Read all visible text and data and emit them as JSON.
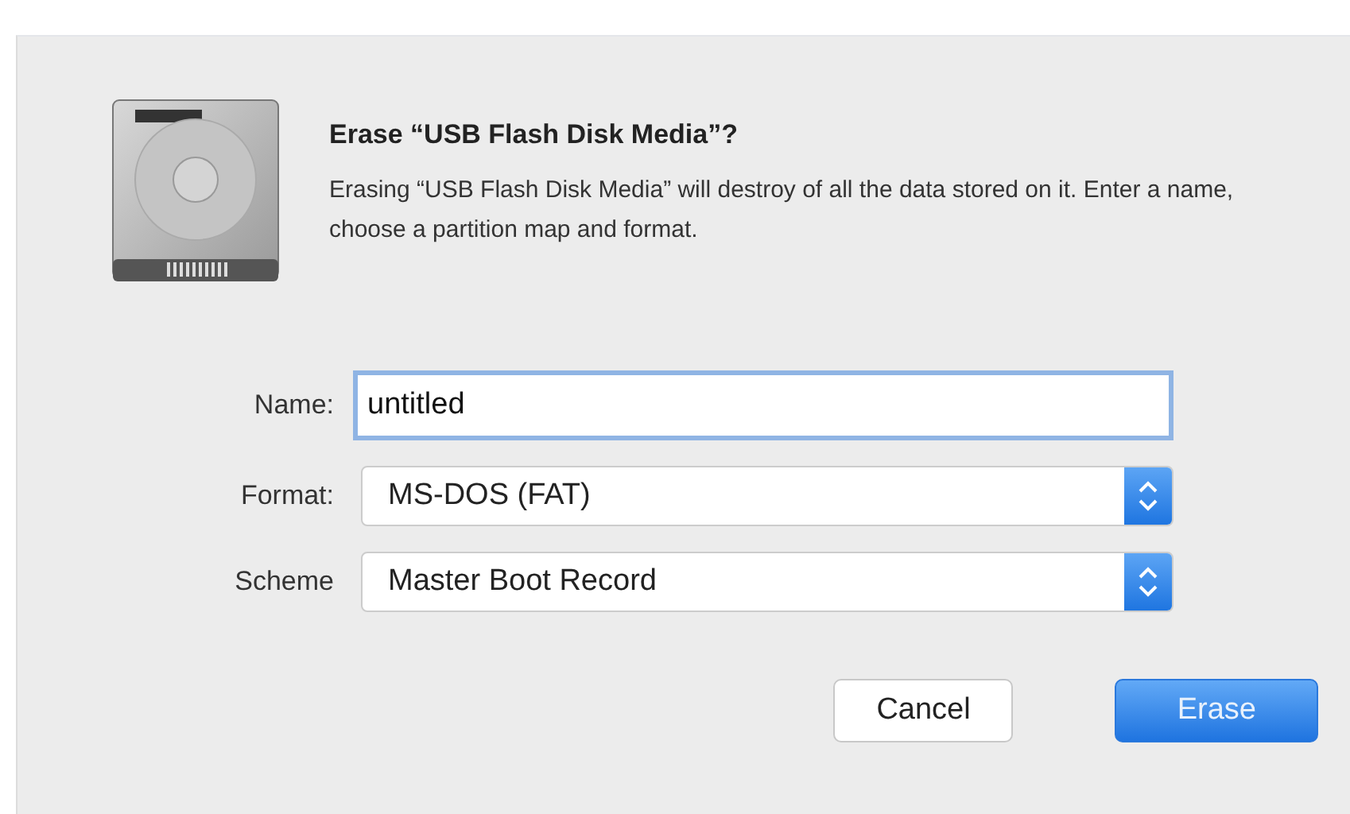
{
  "dialog": {
    "title": "Erase “USB Flash Disk Media”?",
    "message": "Erasing “USB Flash Disk Media” will destroy of all the data stored on it. Enter a name, choose a partition map and format.",
    "fields": [
      {
        "kind": "text",
        "label": "Name:",
        "value": "untitled",
        "focused": true
      },
      {
        "kind": "select",
        "label": "Format:",
        "value": "MS-DOS (FAT)"
      },
      {
        "kind": "select",
        "label": "Scheme",
        "value": "Master Boot Record"
      }
    ],
    "buttons": [
      {
        "label": "Cancel",
        "default": false
      },
      {
        "label": "Erase",
        "default": true
      }
    ]
  }
}
